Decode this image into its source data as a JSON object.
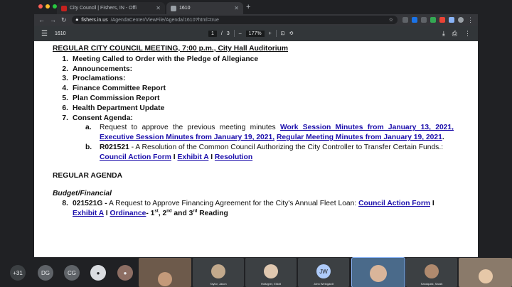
{
  "browser": {
    "tabs": [
      {
        "label": "City Council | Fishers, IN - Offi",
        "active": false
      },
      {
        "label": "1610",
        "active": true
      }
    ],
    "url_host": "fishers.in.us",
    "url_path": "/AgendaCenter/ViewFile/Agenda/1610?html=true"
  },
  "pdf_viewer": {
    "title": "1610",
    "page_current": "1",
    "page_separator": "/",
    "page_total": "3",
    "zoom": "177%"
  },
  "document": {
    "title": "REGULAR CITY COUNCIL MEETING, 7:00 p.m., City Hall Auditorium",
    "items": [
      {
        "num": "1.",
        "text": "Meeting Called to Order with the Pledge of Allegiance"
      },
      {
        "num": "2.",
        "text": "Announcements:"
      },
      {
        "num": "3.",
        "text": "Proclamations:"
      },
      {
        "num": "4.",
        "text": "Finance Committee Report"
      },
      {
        "num": "5.",
        "text": "Plan Commission Report"
      },
      {
        "num": "6.",
        "text": "Health Department Update"
      },
      {
        "num": "7.",
        "text": "Consent Agenda:"
      }
    ],
    "consent_a": {
      "letter": "a.",
      "text": "Request to approve the previous meeting minutes",
      "link1": "Work Session Minutes from January 13, 2021,",
      "link2": "Executive Session Minutes from January 19, 2021,",
      "link3": "Regular Meeting Minutes from January 19, 2021",
      "end": "."
    },
    "consent_b": {
      "letter": "b.",
      "code": "R021521",
      "text": " - A Resolution of the Common Council Authorizing the City Controller to Transfer Certain Funds.:",
      "link1": "Council Action Form",
      "sep1": " I ",
      "link2": "Exhibit A",
      "sep2": " I ",
      "link3": "Resolution"
    },
    "regular_heading": "REGULAR AGENDA",
    "budget_heading": "Budget/Financial",
    "item8": {
      "num": "8.",
      "code": "021521G -",
      "text": " A Request to Approve Financing Agreement for the City's Annual Fleet Loan:",
      "link1": "Council Action Form",
      "sep1": " I",
      "link2": "Exhibit A",
      "sep2": " I ",
      "link3": "Ordinance",
      "reading_prefix": "- 1",
      "sup1": "st",
      "reading_mid": ", 2",
      "sup2": "nd",
      "reading_and": " and 3",
      "sup3": "rd",
      "reading_end": " Reading"
    }
  },
  "participants": {
    "overflow_count": "+31",
    "initials": [
      "DG",
      "CG",
      "JW"
    ],
    "names": [
      "Taylor, Jason",
      "Holtzgrer, Elliott",
      "John Weingardt",
      "Sandquist, Sarah"
    ]
  },
  "colors": {
    "link": "#1a0dab",
    "pdf_toolbar": "#323639",
    "chrome_dark": "#202124"
  }
}
